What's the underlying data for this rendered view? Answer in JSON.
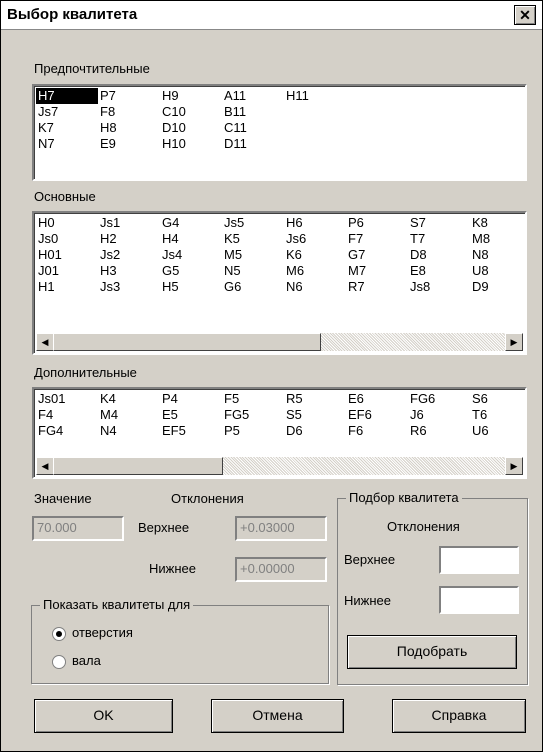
{
  "window": {
    "title": "Выбор квалитета",
    "close_glyph": "✕"
  },
  "preferred": {
    "label": "Предпочтительные",
    "columns": [
      [
        "H7",
        "Js7",
        "K7",
        "N7"
      ],
      [
        "P7",
        "F8",
        "H8",
        "E9"
      ],
      [
        "H9",
        "C10",
        "D10",
        "H10"
      ],
      [
        "A11",
        "B11",
        "C11",
        "D11"
      ],
      [
        "H11"
      ]
    ],
    "selected": "H7"
  },
  "main": {
    "label": "Основные",
    "columns": [
      [
        "H0",
        "Js0",
        "H01",
        "J01",
        "H1"
      ],
      [
        "Js1",
        "H2",
        "Js2",
        "H3",
        "Js3"
      ],
      [
        "G4",
        "H4",
        "Js4",
        "G5",
        "H5"
      ],
      [
        "Js5",
        "K5",
        "M5",
        "N5",
        "G6"
      ],
      [
        "H6",
        "Js6",
        "K6",
        "M6",
        "N6"
      ],
      [
        "P6",
        "F7",
        "G7",
        "M7",
        "R7"
      ],
      [
        "S7",
        "T7",
        "D8",
        "E8",
        "Js8"
      ],
      [
        "K8",
        "M8",
        "N8",
        "U8",
        "D9"
      ]
    ]
  },
  "additional": {
    "label": "Дополнительные",
    "columns": [
      [
        "Js01",
        "F4",
        "FG4"
      ],
      [
        "K4",
        "M4",
        "N4"
      ],
      [
        "P4",
        "E5",
        "EF5"
      ],
      [
        "F5",
        "FG5",
        "P5"
      ],
      [
        "R5",
        "S5",
        "D6"
      ],
      [
        "E6",
        "EF6",
        "F6"
      ],
      [
        "FG6",
        "J6",
        "R6"
      ],
      [
        "S6",
        "T6",
        "U6"
      ]
    ]
  },
  "value": {
    "label": "Значение",
    "field": "70.000",
    "deviations_label": "Отклонения",
    "upper_label": "Верхнее",
    "upper_value": "+0.03000",
    "lower_label": "Нижнее",
    "lower_value": "+0.00000"
  },
  "show_for": {
    "group_label": "Показать квалитеты для",
    "option_hole": "отверстия",
    "option_shaft": "вала",
    "selected": "отверстия"
  },
  "pick": {
    "group_label": "Подбор квалитета",
    "deviations_label": "Отклонения",
    "upper_label": "Верхнее",
    "upper_value": "",
    "lower_label": "Нижнее",
    "lower_value": "",
    "button": "Подобрать"
  },
  "buttons": {
    "ok": "OK",
    "cancel": "Отмена",
    "help": "Справка"
  }
}
